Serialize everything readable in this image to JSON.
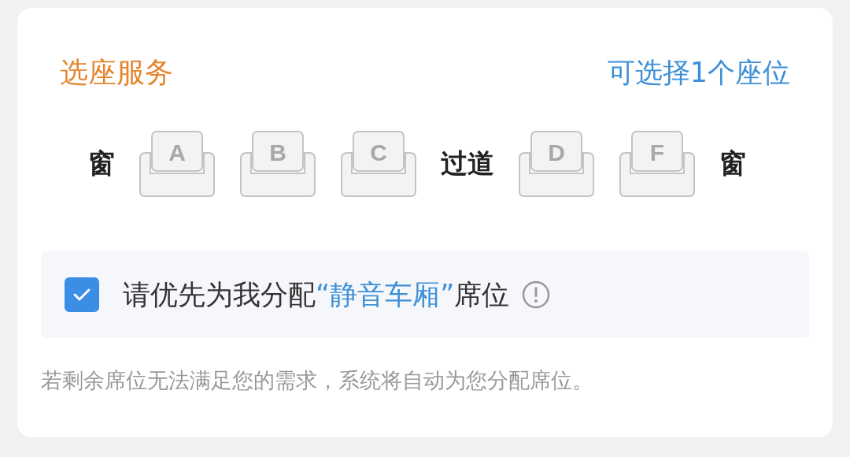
{
  "header": {
    "title": "选座服务",
    "availability": "可选择1个座位"
  },
  "seat_row": [
    {
      "kind": "label",
      "text": "窗"
    },
    {
      "kind": "seat",
      "letter": "A",
      "selected": false
    },
    {
      "kind": "seat",
      "letter": "B",
      "selected": false
    },
    {
      "kind": "seat",
      "letter": "C",
      "selected": false
    },
    {
      "kind": "label",
      "text": "过道"
    },
    {
      "kind": "seat",
      "letter": "D",
      "selected": false
    },
    {
      "kind": "seat",
      "letter": "F",
      "selected": false
    },
    {
      "kind": "label",
      "text": "窗"
    }
  ],
  "quiet_carriage": {
    "checked": true,
    "text_before": "请优先为我分配",
    "highlight": "“静音车厢”",
    "text_after": "席位"
  },
  "note": "若剩余席位无法满足您的需求，系统将自动为您分配席位。"
}
